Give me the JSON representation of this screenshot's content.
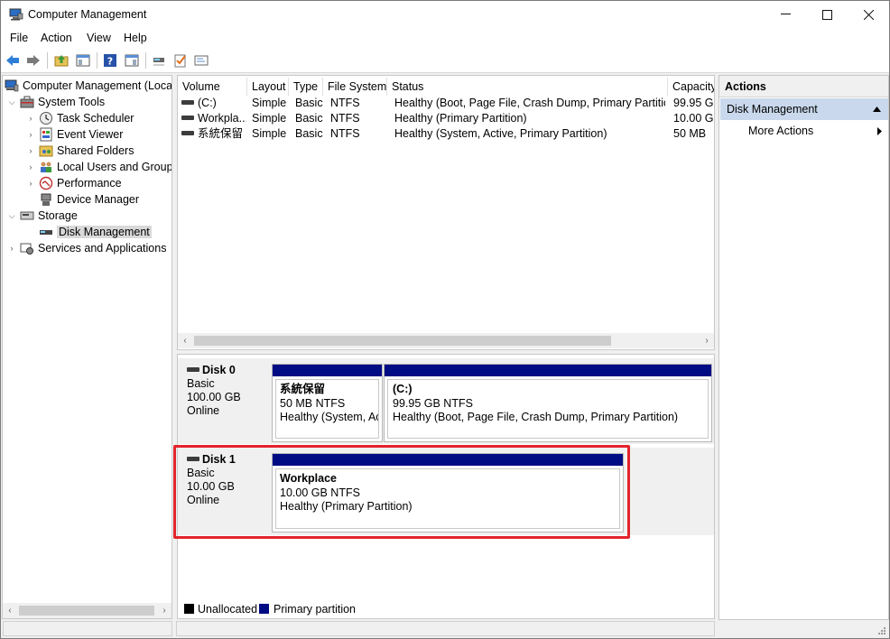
{
  "window": {
    "title": "Computer Management",
    "minimize": "—",
    "maximize": "☐",
    "close": "✕"
  },
  "menu": [
    "File",
    "Action",
    "View",
    "Help"
  ],
  "toolbar": [
    "back-icon",
    "forward-icon",
    "up-folder-icon",
    "show-hide-tree-icon",
    "help-icon",
    "properties-pane-icon",
    "connect-icon",
    "checklist-icon",
    "settings-icon"
  ],
  "tree": {
    "root": "Computer Management (Local",
    "system_tools": "System Tools",
    "task_scheduler": "Task Scheduler",
    "event_viewer": "Event Viewer",
    "shared_folders": "Shared Folders",
    "local_users": "Local Users and Groups",
    "performance": "Performance",
    "device_manager": "Device Manager",
    "storage": "Storage",
    "disk_management": "Disk Management",
    "services": "Services and Applications"
  },
  "volumes": {
    "headers": [
      "Volume",
      "Layout",
      "Type",
      "File System",
      "Status",
      "Capacity"
    ],
    "rows": [
      [
        "(C:)",
        "Simple",
        "Basic",
        "NTFS",
        "Healthy (Boot, Page File, Crash Dump, Primary Partition)",
        "99.95 GB"
      ],
      [
        "Workpla...",
        "Simple",
        "Basic",
        "NTFS",
        "Healthy (Primary Partition)",
        "10.00 GB"
      ],
      [
        "系統保留",
        "Simple",
        "Basic",
        "NTFS",
        "Healthy (System, Active, Primary Partition)",
        "50 MB"
      ]
    ]
  },
  "disks": [
    {
      "name": "Disk 0",
      "type": "Basic",
      "size": "100.00 GB",
      "state": "Online",
      "partitions": [
        {
          "name": "系統保留",
          "size": "50 MB NTFS",
          "status": "Healthy (System, Act"
        },
        {
          "name": "(C:)",
          "size": "99.95 GB NTFS",
          "status": "Healthy (Boot, Page File, Crash Dump, Primary Partition)"
        }
      ]
    },
    {
      "name": "Disk 1",
      "type": "Basic",
      "size": "10.00 GB",
      "state": "Online",
      "partitions": [
        {
          "name": "Workplace",
          "size": "10.00 GB NTFS",
          "status": "Healthy (Primary Partition)"
        }
      ]
    }
  ],
  "legend": {
    "unallocated": "Unallocated",
    "primary": "Primary partition"
  },
  "colors": {
    "partition_bar": "#000c84",
    "unallocated": "#000000",
    "highlight": "#e3232b",
    "section_bg": "#c9d8ec"
  },
  "actions": {
    "title": "Actions",
    "section": "Disk Management",
    "more": "More Actions"
  }
}
